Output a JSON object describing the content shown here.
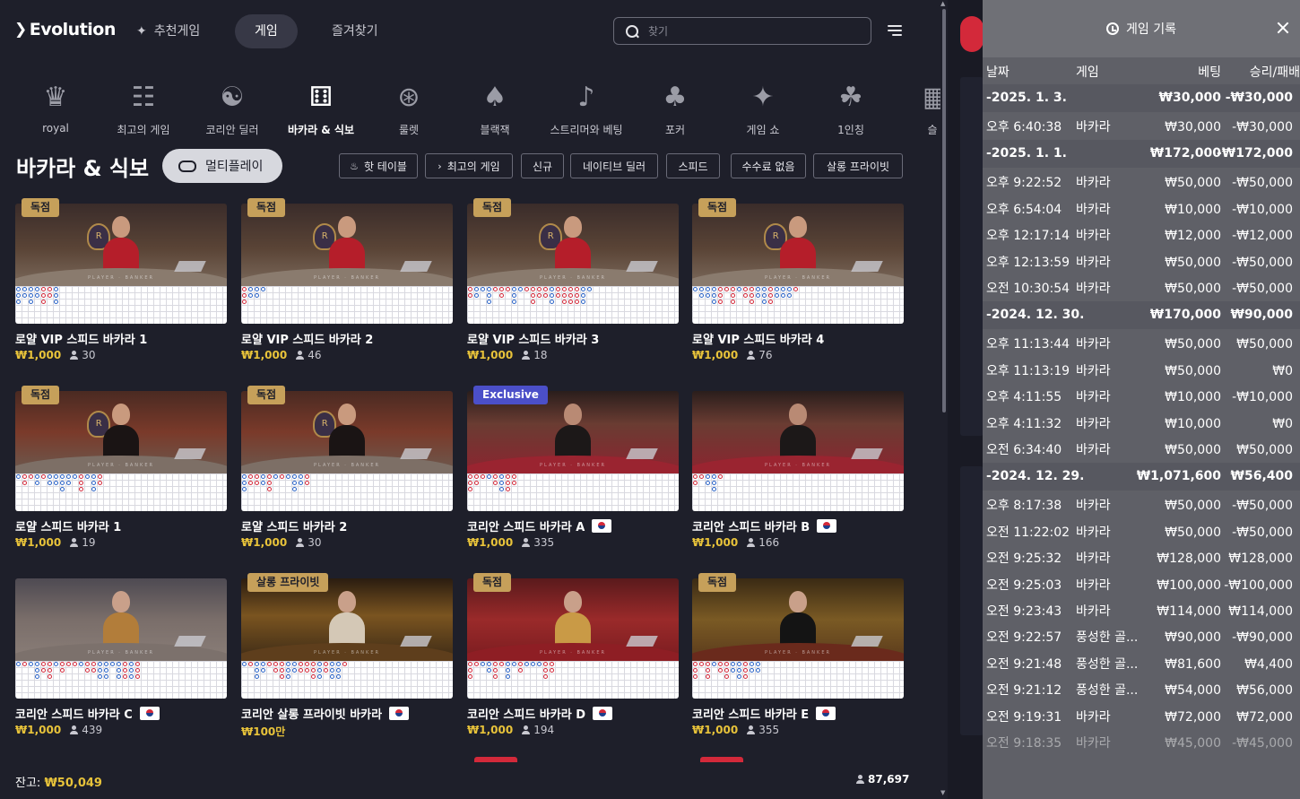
{
  "app": {
    "logo": "Evolution"
  },
  "nav": {
    "recommended": "추천게임",
    "games": "게임",
    "favorites": "즐겨찾기"
  },
  "search": {
    "placeholder": "찾기"
  },
  "categories": [
    {
      "label": "royal",
      "icon": "royal-crest-icon",
      "glyph": "♛"
    },
    {
      "label": "최고의 게임",
      "icon": "podium-icon",
      "glyph": "☷"
    },
    {
      "label": "코리안 딜러",
      "icon": "korean-dealer-icon",
      "glyph": "☯"
    },
    {
      "label": "바카라 & 식보",
      "icon": "baccarat-dice-icon",
      "glyph": "⚅"
    },
    {
      "label": "룰렛",
      "icon": "roulette-icon",
      "glyph": "⊛"
    },
    {
      "label": "블랙잭",
      "icon": "blackjack-cards-icon",
      "glyph": "♠"
    },
    {
      "label": "스트리머와 베팅",
      "icon": "microphone-icon",
      "glyph": "♪"
    },
    {
      "label": "포커",
      "icon": "poker-cards-icon",
      "glyph": "♣"
    },
    {
      "label": "게임 쇼",
      "icon": "game-show-mic-icon",
      "glyph": "✦"
    },
    {
      "label": "1인칭",
      "icon": "first-person-icon",
      "glyph": "☘"
    },
    {
      "label": "슬",
      "icon": "slots-icon",
      "glyph": "▦"
    }
  ],
  "section": {
    "title": "바카라 & 식보",
    "multiplay": "멀티플레이"
  },
  "filters": [
    {
      "label": "핫 테이블",
      "icon": "flame-icon",
      "glyph": "♨"
    },
    {
      "label": "최고의 게임",
      "icon": "chevron-right-icon",
      "glyph": "›"
    },
    {
      "label": "신규",
      "icon": "",
      "glyph": ""
    },
    {
      "label": "네이티브 딜러",
      "icon": "",
      "glyph": ""
    },
    {
      "label": "스피드",
      "icon": "",
      "glyph": ""
    },
    {
      "label": "수수료 없음",
      "icon": "",
      "glyph": ""
    },
    {
      "label": "살롱 프라이빗",
      "icon": "",
      "glyph": ""
    }
  ],
  "tiles": [
    {
      "name": "로얄 VIP 스피드 바카라 1",
      "bet": "₩1,000",
      "players": "30",
      "badge": "독점",
      "flag": false,
      "theme": "royal"
    },
    {
      "name": "로얄 VIP 스피드 바카라 2",
      "bet": "₩1,000",
      "players": "46",
      "badge": "독점",
      "flag": false,
      "theme": "royal"
    },
    {
      "name": "로얄 VIP 스피드 바카라 3",
      "bet": "₩1,000",
      "players": "18",
      "badge": "독점",
      "flag": false,
      "theme": "royal"
    },
    {
      "name": "로얄 VIP 스피드 바카라 4",
      "bet": "₩1,000",
      "players": "76",
      "badge": "독점",
      "flag": false,
      "theme": "royal"
    },
    {
      "name": "로얄 스피드 바카라 1",
      "bet": "₩1,000",
      "players": "19",
      "badge": "독점",
      "flag": false,
      "theme": "royal2"
    },
    {
      "name": "로얄 스피드 바카라 2",
      "bet": "₩1,000",
      "players": "30",
      "badge": "독점",
      "flag": false,
      "theme": "royal2"
    },
    {
      "name": "코리안 스피드 바카라 A",
      "bet": "₩1,000",
      "players": "335",
      "badge": "Exclusive",
      "flag": true,
      "theme": "korean"
    },
    {
      "name": "코리안 스피드 바카라 B",
      "bet": "₩1,000",
      "players": "166",
      "badge": "",
      "flag": true,
      "theme": "korean"
    },
    {
      "name": "코리안 스피드 바카라 C",
      "bet": "₩1,000",
      "players": "439",
      "badge": "",
      "flag": true,
      "theme": "palace"
    },
    {
      "name": "코리안 살롱 프라이빗 바카라",
      "bet": "₩100만",
      "players": "",
      "badge": "살롱 프라이빗",
      "flag": true,
      "theme": "salon"
    },
    {
      "name": "코리안 스피드 바카라 D",
      "bet": "₩1,000",
      "players": "194",
      "badge": "독점",
      "flag": true,
      "theme": "red"
    },
    {
      "name": "코리안 스피드 바카라 E",
      "bet": "₩1,000",
      "players": "355",
      "badge": "독점",
      "flag": true,
      "theme": "gold"
    }
  ],
  "footer": {
    "balance_label": "잔고:",
    "balance_value": "₩50,049",
    "online": "87,697"
  },
  "history": {
    "title": "게임 기록",
    "headers": {
      "date": "날짜",
      "game": "게임",
      "bet": "베팅",
      "winloss": "승리/패배"
    },
    "rows": [
      {
        "type": "group",
        "date": "-2025. 1. 3.",
        "game": "",
        "bet": "₩30,000",
        "win": "-₩30,000"
      },
      {
        "type": "row",
        "date": "오후 6:40:38",
        "game": "바카라",
        "bet": "₩30,000",
        "win": "-₩30,000"
      },
      {
        "type": "group",
        "date": "-2025. 1. 1.",
        "game": "",
        "bet": "₩172,000",
        "win": "-₩172,000"
      },
      {
        "type": "row",
        "date": "오후 9:22:52",
        "game": "바카라",
        "bet": "₩50,000",
        "win": "-₩50,000"
      },
      {
        "type": "row",
        "date": "오후 6:54:04",
        "game": "바카라",
        "bet": "₩10,000",
        "win": "-₩10,000"
      },
      {
        "type": "row",
        "date": "오후 12:17:14",
        "game": "바카라",
        "bet": "₩12,000",
        "win": "-₩12,000"
      },
      {
        "type": "row",
        "date": "오후 12:13:59",
        "game": "바카라",
        "bet": "₩50,000",
        "win": "-₩50,000"
      },
      {
        "type": "row",
        "date": "오전 10:30:54",
        "game": "바카라",
        "bet": "₩50,000",
        "win": "-₩50,000"
      },
      {
        "type": "group",
        "date": "-2024. 12. 30.",
        "game": "",
        "bet": "₩170,000",
        "win": "₩90,000"
      },
      {
        "type": "row",
        "date": "오후 11:13:44",
        "game": "바카라",
        "bet": "₩50,000",
        "win": "₩50,000"
      },
      {
        "type": "row",
        "date": "오후 11:13:19",
        "game": "바카라",
        "bet": "₩50,000",
        "win": "₩0"
      },
      {
        "type": "row",
        "date": "오후 4:11:55",
        "game": "바카라",
        "bet": "₩10,000",
        "win": "-₩10,000"
      },
      {
        "type": "row",
        "date": "오후 4:11:32",
        "game": "바카라",
        "bet": "₩10,000",
        "win": "₩0"
      },
      {
        "type": "row",
        "date": "오전 6:34:40",
        "game": "바카라",
        "bet": "₩50,000",
        "win": "₩50,000"
      },
      {
        "type": "group",
        "date": "-2024. 12. 29.",
        "game": "",
        "bet": "₩1,071,600",
        "win": "₩56,400"
      },
      {
        "type": "row",
        "date": "오후 8:17:38",
        "game": "바카라",
        "bet": "₩50,000",
        "win": "-₩50,000"
      },
      {
        "type": "row",
        "date": "오전 11:22:02",
        "game": "바카라",
        "bet": "₩50,000",
        "win": "-₩50,000"
      },
      {
        "type": "row",
        "date": "오전 9:25:32",
        "game": "바카라",
        "bet": "₩128,000",
        "win": "₩128,000"
      },
      {
        "type": "row",
        "date": "오전 9:25:03",
        "game": "바카라",
        "bet": "₩100,000",
        "win": "-₩100,000"
      },
      {
        "type": "row",
        "date": "오전 9:23:43",
        "game": "바카라",
        "bet": "₩114,000",
        "win": "₩114,000"
      },
      {
        "type": "row",
        "date": "오전 9:22:57",
        "game": "풍성한 골...",
        "bet": "₩90,000",
        "win": "-₩90,000"
      },
      {
        "type": "row",
        "date": "오전 9:21:48",
        "game": "풍성한 골...",
        "bet": "₩81,600",
        "win": "₩4,400"
      },
      {
        "type": "row",
        "date": "오전 9:21:12",
        "game": "풍성한 골...",
        "bet": "₩54,000",
        "win": "₩56,000"
      },
      {
        "type": "row",
        "date": "오전 9:19:31",
        "game": "바카라",
        "bet": "₩72,000",
        "win": "₩72,000"
      },
      {
        "type": "row",
        "date": "오전 9:18:35",
        "game": "바카라",
        "bet": "₩45,000",
        "win": "-₩45,000"
      }
    ]
  }
}
